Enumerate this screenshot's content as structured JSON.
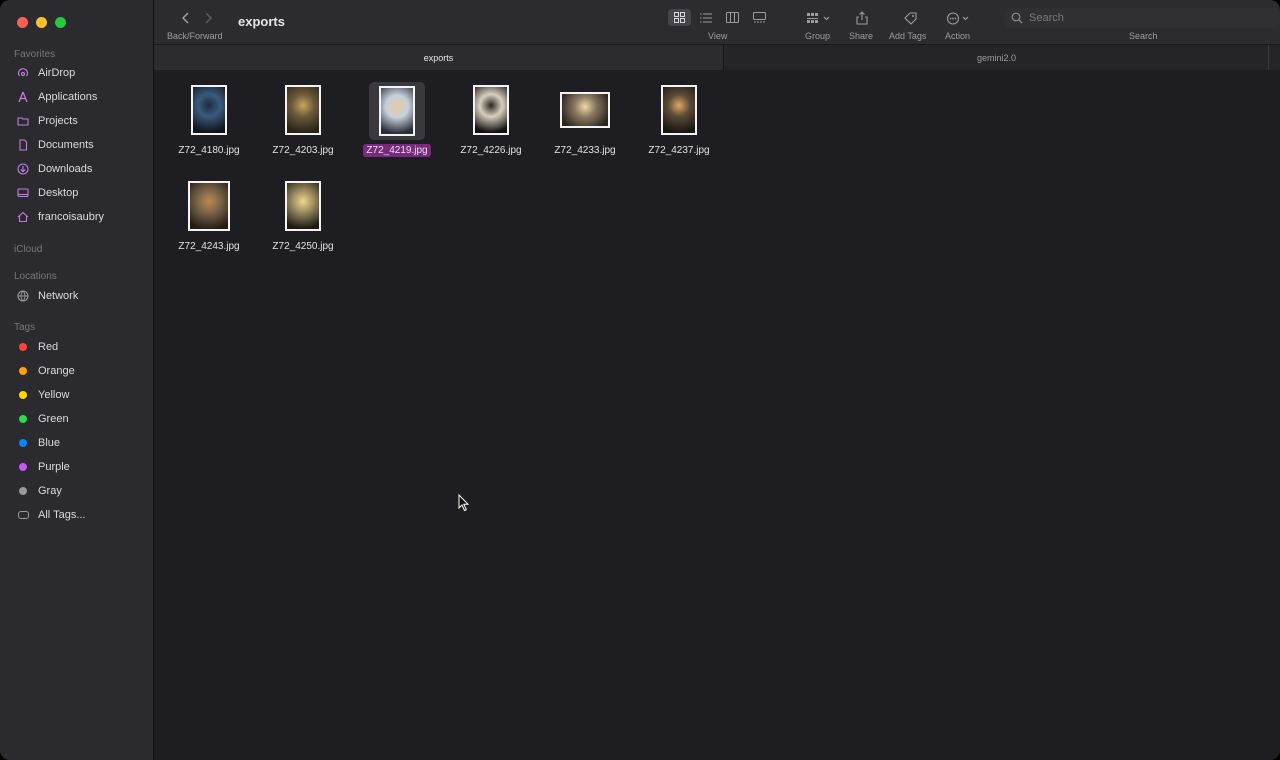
{
  "sidebar": {
    "favorites_header": "Favorites",
    "favorites": [
      {
        "label": "AirDrop",
        "icon": "airdrop-icon"
      },
      {
        "label": "Applications",
        "icon": "applications-icon"
      },
      {
        "label": "Projects",
        "icon": "folder-icon"
      },
      {
        "label": "Documents",
        "icon": "document-icon"
      },
      {
        "label": "Downloads",
        "icon": "download-icon"
      },
      {
        "label": "Desktop",
        "icon": "desktop-icon"
      },
      {
        "label": "francoisaubry",
        "icon": "home-icon"
      }
    ],
    "icloud_header": "iCloud",
    "locations_header": "Locations",
    "locations": [
      {
        "label": "Network",
        "icon": "network-icon"
      }
    ],
    "tags_header": "Tags",
    "tags": [
      {
        "label": "Red",
        "color": "#ff453a"
      },
      {
        "label": "Orange",
        "color": "#ff9f0a"
      },
      {
        "label": "Yellow",
        "color": "#ffd60a"
      },
      {
        "label": "Green",
        "color": "#32d74b"
      },
      {
        "label": "Blue",
        "color": "#0a84ff"
      },
      {
        "label": "Purple",
        "color": "#bf5af2"
      },
      {
        "label": "Gray",
        "color": "#98989d"
      },
      {
        "label": "All Tags...",
        "color": "none"
      }
    ]
  },
  "toolbar": {
    "title": "exports",
    "back_forward_label": "Back/Forward",
    "view_label": "View",
    "group_label": "Group",
    "share_label": "Share",
    "add_tags_label": "Add Tags",
    "action_label": "Action",
    "search_label": "Search",
    "search_placeholder": "Search"
  },
  "tabs": [
    {
      "label": "exports",
      "active": true
    },
    {
      "label": "gemini2.0",
      "active": false
    }
  ],
  "files": [
    {
      "name": "Z72_4180.jpg",
      "orientation": "portrait",
      "colors": [
        "#3a5a7a",
        "#1c2c40",
        "#0f141c"
      ]
    },
    {
      "name": "Z72_4203.jpg",
      "orientation": "portrait",
      "colors": [
        "#6b5a3a",
        "#c9a660",
        "#2a2418"
      ]
    },
    {
      "name": "Z72_4219.jpg",
      "orientation": "portrait",
      "colors": [
        "#c7d0dc",
        "#e8c8a0",
        "#2a2e38"
      ],
      "selected": true
    },
    {
      "name": "Z72_4226.jpg",
      "orientation": "portrait",
      "colors": [
        "#d8cfc0",
        "#2a2520",
        "#121010"
      ]
    },
    {
      "name": "Z72_4233.jpg",
      "orientation": "landscape",
      "colors": [
        "#8a7860",
        "#f2d9a8",
        "#2a251f"
      ]
    },
    {
      "name": "Z72_4237.jpg",
      "orientation": "portrait",
      "colors": [
        "#5a4a38",
        "#e0a860",
        "#1a1612"
      ]
    },
    {
      "name": "Z72_4243.jpg",
      "orientation": "portrait",
      "colors": [
        "#7a6448",
        "#c08850",
        "#241c14"
      ]
    },
    {
      "name": "Z72_4250.jpg",
      "orientation": "portrait",
      "colors": [
        "#9a8a60",
        "#f0d890",
        "#1c1a12"
      ]
    }
  ]
}
